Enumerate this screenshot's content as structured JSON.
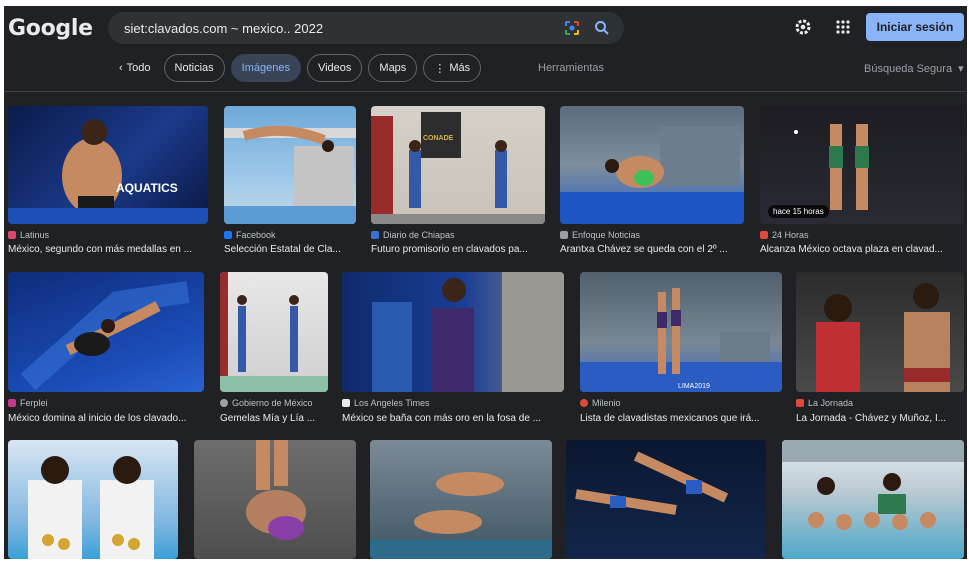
{
  "header": {
    "logo": "Google",
    "search_value": "siet:clavados.com ~ mexico.. 2022",
    "signin_label": "Iniciar sesión"
  },
  "filters": {
    "back_label": "Todo",
    "chips": [
      "Noticias",
      "Imágenes",
      "Videos",
      "Maps",
      "Más"
    ],
    "active": "Imágenes",
    "tools_label": "Herramientas",
    "safe_search_label": "Búsqueda Segura"
  },
  "results": [
    {
      "source": "Latinus",
      "title": "México, segundo con más medallas en ...",
      "overlay": "AQUATICS"
    },
    {
      "source": "Facebook",
      "title": "Selección Estatal de Cla..."
    },
    {
      "source": "Diario de Chiapas",
      "title": "Futuro promisorio en clavados pa...",
      "overlay": "CONADE"
    },
    {
      "source": "Enfoque Noticias",
      "title": "Arantxa Chávez se queda con el 2º ..."
    },
    {
      "source": "24 Horas",
      "title": "Alcanza México octava plaza en clavad...",
      "badge": "hace 15 horas"
    },
    {
      "source": "Ferplei",
      "title": "México domina al inicio de los clavado..."
    },
    {
      "source": "Gobierno de México",
      "title": "Gemelas Mía y Lía ..."
    },
    {
      "source": "Los Angeles Times",
      "title": "México se baña con más oro en la fosa de ..."
    },
    {
      "source": "Milenio",
      "title": "Lista de clavadistas mexicanos que irá...",
      "overlay": "LIMA2019"
    },
    {
      "source": "La Jornada",
      "title": "La Jornada - Chávez y Muñoz, I..."
    },
    {
      "source": "",
      "title": ""
    },
    {
      "source": "",
      "title": ""
    },
    {
      "source": "",
      "title": ""
    },
    {
      "source": "",
      "title": ""
    },
    {
      "source": "",
      "title": ""
    }
  ],
  "colors": {
    "background": "#202124",
    "accent": "#8ab4f8",
    "active_chip": "#394457"
  }
}
